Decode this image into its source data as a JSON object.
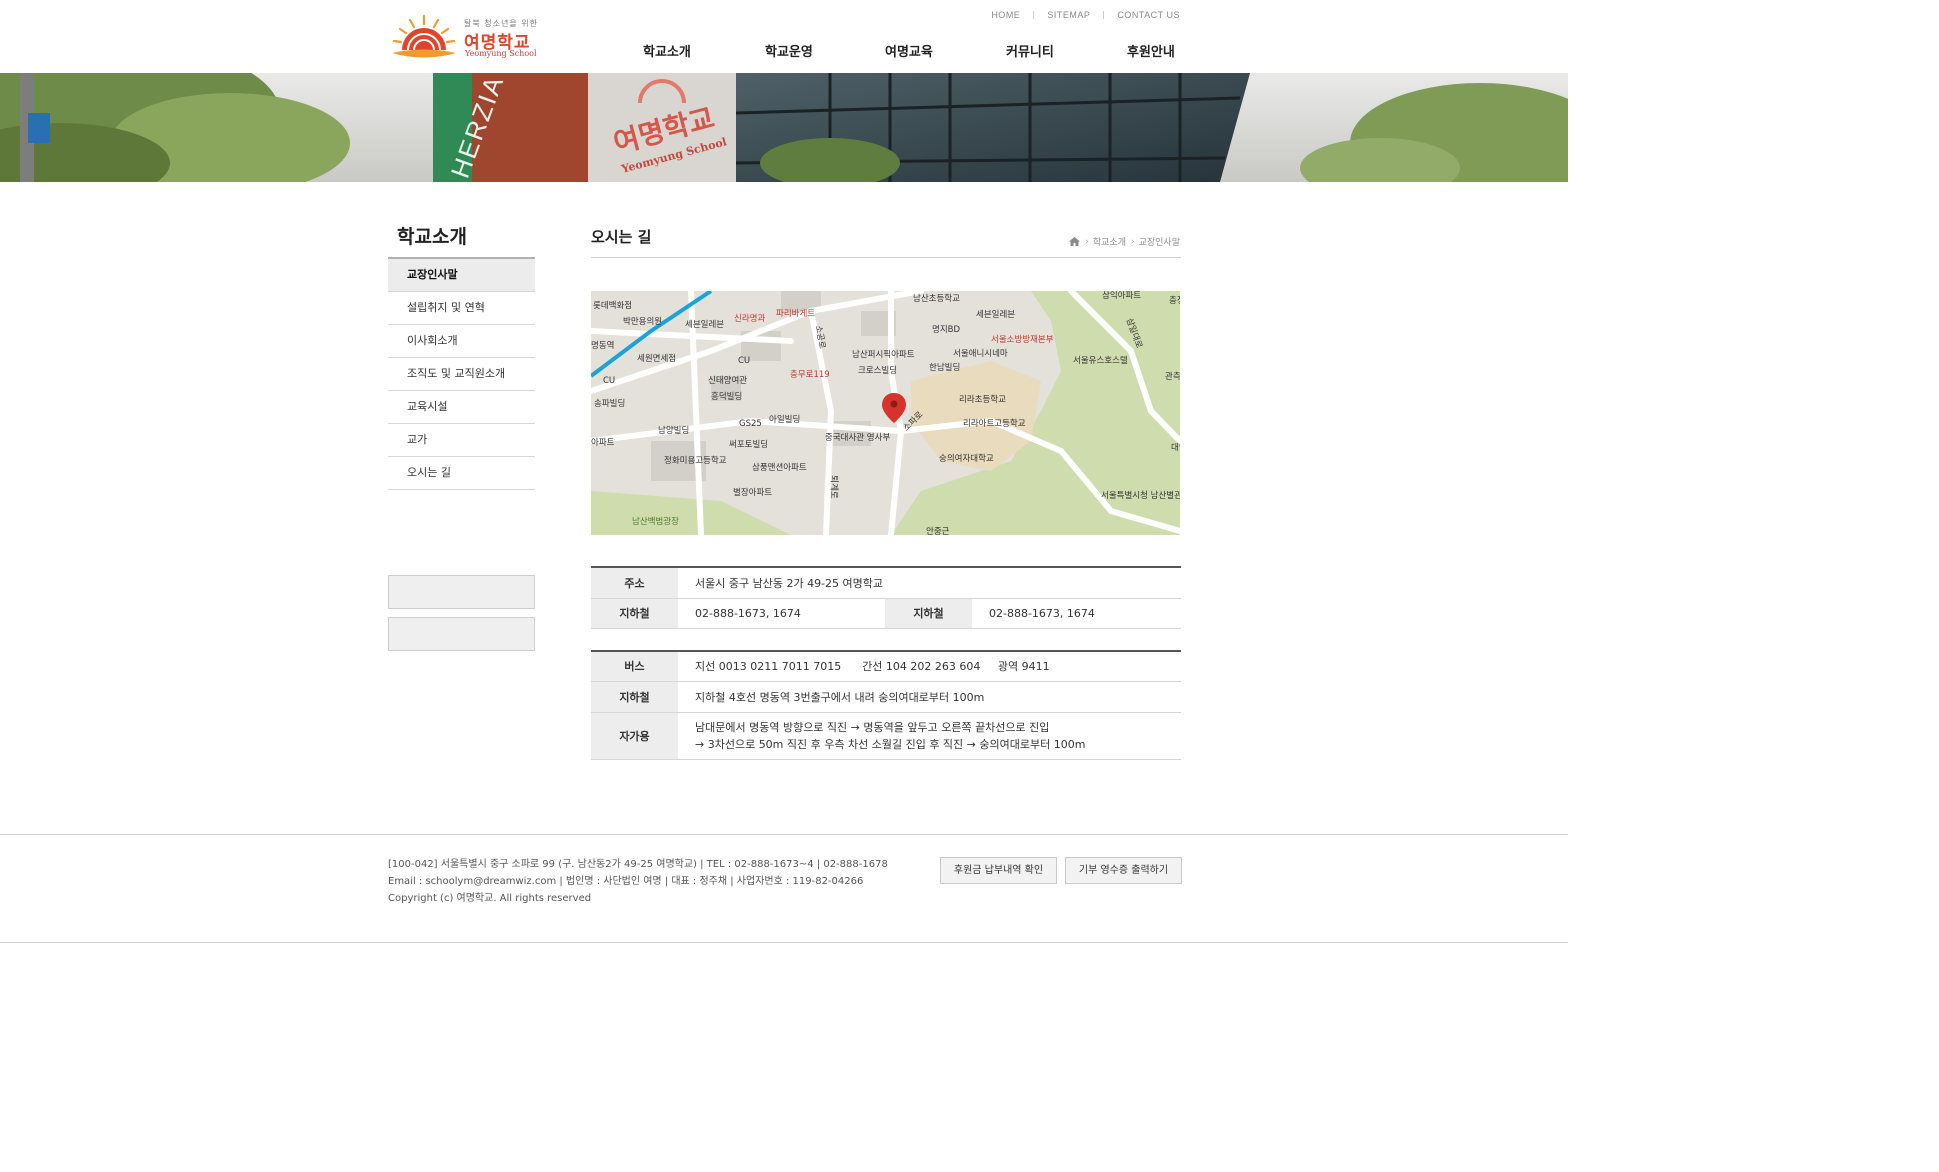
{
  "header": {
    "logo": {
      "tagline": "탈북 청소년을 위한",
      "name": "여명학교",
      "english": "Yeomyung School"
    },
    "util_links": [
      "HOME",
      "SITEMAP",
      "CONTACT US"
    ],
    "gnb": [
      "학교소개",
      "학교운영",
      "여명교육",
      "커뮤니티",
      "후원안내"
    ]
  },
  "banner": {
    "sign_text": "여명학교",
    "sign_english": "Yeomyung School",
    "side_sign": "HERZIA"
  },
  "sidebar": {
    "title": "학교소개",
    "items": [
      {
        "label": "교장인사말"
      },
      {
        "label": "설립취지 및 연혁"
      },
      {
        "label": "이사회소개"
      },
      {
        "label": "조직도 및 교직원소개"
      },
      {
        "label": "교육시설"
      },
      {
        "label": "교가"
      },
      {
        "label": "오시는 길"
      }
    ]
  },
  "content": {
    "title": "오시는 길",
    "breadcrumb": [
      "학교소개",
      "교장인사말"
    ]
  },
  "map": {
    "labels": [
      "롯데백화점",
      "박만용의원",
      "세븐일레븐",
      "신라명과",
      "파리바게트",
      "남산초등학교",
      "삼익아파트",
      "충정시",
      "명지BD",
      "세븐일레븐",
      "서울소방방재본부",
      "서울유스호스텔",
      "삼일대로",
      "명동역",
      "세원면세점",
      "CU",
      "CU",
      "충무로119",
      "남산퍼시픽아파트",
      "서울애니시네마",
      "크로스빌딩",
      "한남빌딩",
      "관측",
      "신태양여관",
      "송파빌딩",
      "흥덕빌딩",
      "리라초등학교",
      "아일빌딩",
      "GS25",
      "리라아트고등학교",
      "남양빌딩",
      "써포토빌딩",
      "중국대사관 영사부",
      "소파로",
      "아파트",
      "정화미용고등학교",
      "삼풍맨션아파트",
      "숭의여자대학교",
      "대명",
      "별장아파트",
      "서울특별시청 남산별관",
      "남산백범광장",
      "안중근",
      "퇴계로",
      "소공로"
    ]
  },
  "info_table_1": {
    "address_label": "주소",
    "address_value": "서울시 중구 남산동 2가 49-25 여명학교",
    "phone_label_1": "지하철",
    "phone_value_1": "02-888-1673, 1674",
    "phone_label_2": "지하철",
    "phone_value_2": "02-888-1673, 1674"
  },
  "info_table_2": {
    "bus_label": "버스",
    "bus_value": "지선 0013 0211 7011 7015      간선 104 202 263 604     광역 9411",
    "subway_label": "지하철",
    "subway_value": "지하철 4호선 명동역 3번출구에서 내려 숭의여대로부터 100m",
    "car_label": "자가용",
    "car_line_1": "남대문에서 명동역 방향으로 직진 → 명동역을 앞두고 오른쪽 끝차선으로 진입",
    "car_line_2": "→ 3차선으로 50m 직진 후 우측 차선 소월길 진입 후 직진 → 숭의여대로부터 100m"
  },
  "footer": {
    "line_1": "[100-042] 서울특별시 중구 소파로 99 (구. 남산동2가 49-25 여명학교) | TEL : 02-888-1673~4 | 02-888-1678",
    "line_2": "Email : schoolym@dreamwiz.com | 법인명 : 사단법인 여명 | 대표 : 정주채 | 사업자번호 : 119-82-04266",
    "line_3": "Copyright (c) 여명학교. All rights reserved",
    "button_1": "후원금 납부내역 확인",
    "button_2": "기부 영수증 출력하기"
  },
  "colors": {
    "brand_red": "#e0452c",
    "brand_orange": "#f19b2c",
    "table_header": "#ededed",
    "sidebar_active": "#ececec"
  }
}
